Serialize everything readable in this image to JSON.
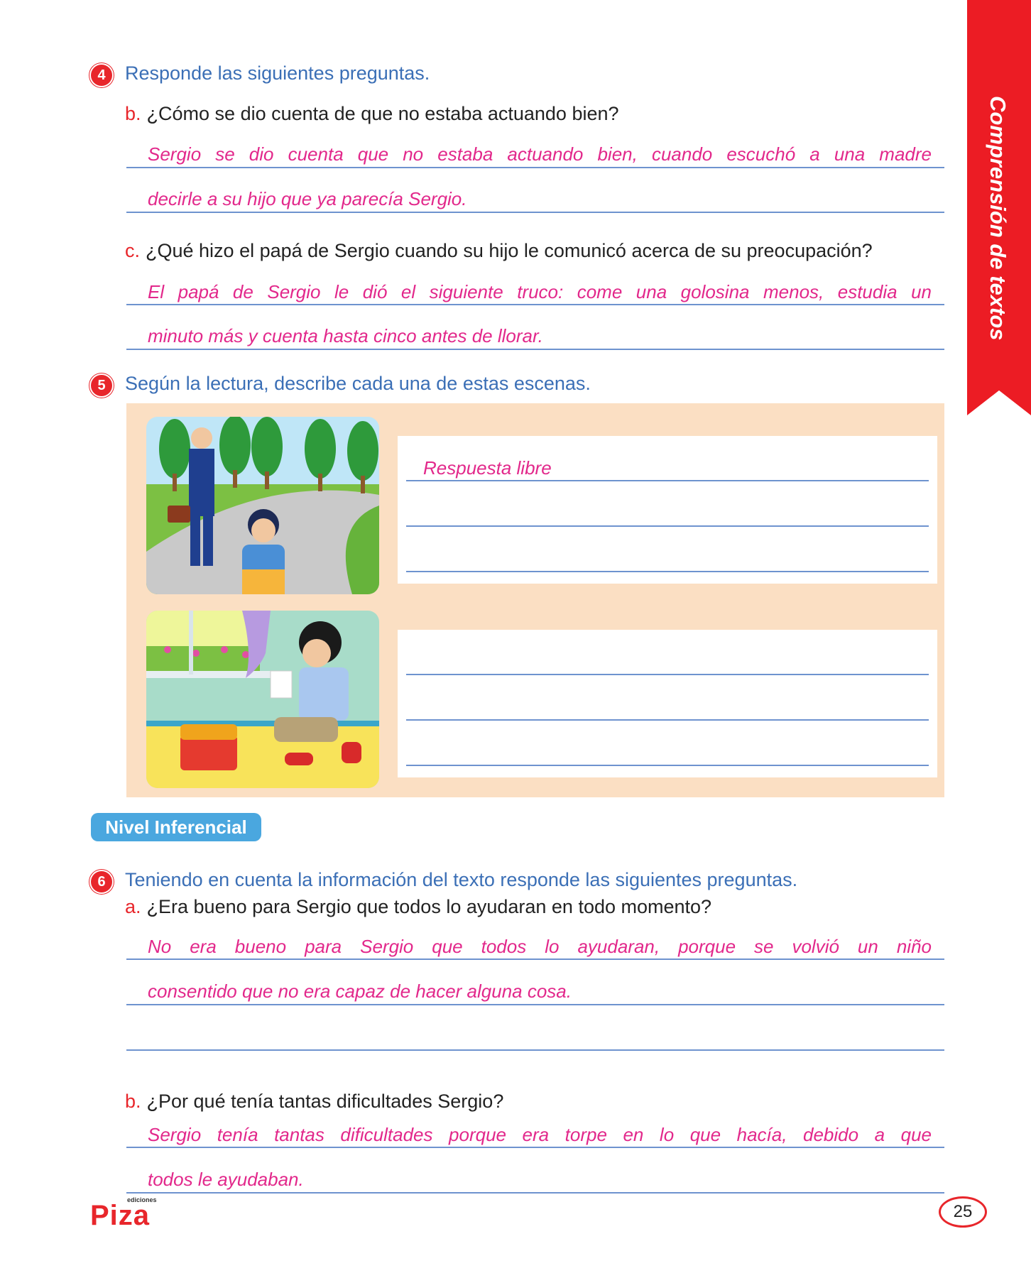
{
  "side_tab": {
    "label": "Comprensión de textos"
  },
  "q4": {
    "number": "4",
    "instruction": "Responde las siguientes preguntas.",
    "b": {
      "letter": "b.",
      "question": "¿Cómo se dio cuenta de que no estaba actuando bien?",
      "answer_lines": [
        "Sergio se dio cuenta que no estaba actuando bien, cuando escuchó a una madre",
        "decirle a su hijo que ya parecía Sergio."
      ]
    },
    "c": {
      "letter": "c.",
      "question": "¿Qué hizo el papá de Sergio cuando su hijo le comunicó acerca de su preocupación?",
      "answer_lines": [
        "El papá de Sergio le dió el siguiente truco: come una golosina menos, estudia un",
        "minuto más y cuenta hasta cinco antes de llorar."
      ]
    }
  },
  "q5": {
    "number": "5",
    "instruction": "Según la lectura, describe cada una de estas escenas.",
    "scene1_answer": "Respuesta libre"
  },
  "level": {
    "label": "Nivel Inferencial"
  },
  "q6": {
    "number": "6",
    "instruction": "Teniendo en cuenta la información del texto responde las siguientes preguntas.",
    "a": {
      "letter": "a.",
      "question": "¿Era bueno para Sergio que todos lo ayudaran en todo momento?",
      "answer_lines": [
        "No era bueno para Sergio que todos lo ayudaran, porque se volvió un niño",
        "consentido que no era capaz de  hacer alguna cosa."
      ]
    },
    "b": {
      "letter": "b.",
      "question": "¿Por qué tenía tantas dificultades Sergio?",
      "answer_lines": [
        "Sergio tenía tantas dificultades porque era torpe en  lo que hacía, debido a que",
        "todos le ayudaban."
      ]
    }
  },
  "footer": {
    "logo_small": "ediciones",
    "logo_main": "Piza",
    "page_number": "25"
  },
  "colors": {
    "accent_red": "#ec1c24",
    "instruction_blue": "#3b6fb6",
    "answer_pink": "#e2288b",
    "rule_blue": "#6e93cf",
    "panel_peach": "#fbdfc3",
    "pill_blue": "#4aa7df"
  }
}
